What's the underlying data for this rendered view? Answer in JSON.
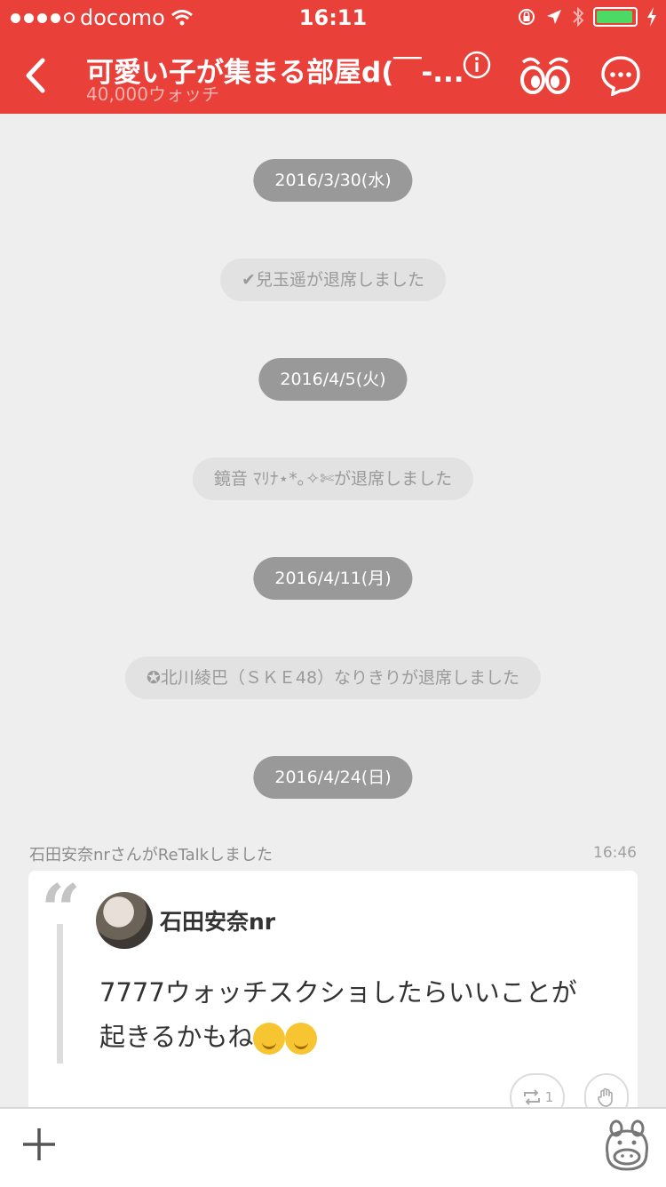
{
  "status_bar": {
    "carrier": "docomo",
    "time": "16:11"
  },
  "header": {
    "title": "可愛い子が集まる部屋d(￣-...",
    "subtitle": "40,000ウォッチ"
  },
  "timeline": {
    "items": [
      {
        "kind": "date",
        "text": "2016/3/30(水)"
      },
      {
        "kind": "system",
        "text": "✔兒玉遥が退席しました"
      },
      {
        "kind": "date",
        "text": "2016/4/5(火)"
      },
      {
        "kind": "system",
        "text": "鏡音  ﾏﾘﾅ⋆*｡✧✄が退席しました"
      },
      {
        "kind": "date",
        "text": "2016/4/11(月)"
      },
      {
        "kind": "system",
        "text": "✪北川綾巴（ＳＫＥ48）なりきりが退席しました"
      },
      {
        "kind": "date",
        "text": "2016/4/24(日)"
      }
    ]
  },
  "retalk": {
    "notice": "石田安奈nrさんがReTalkしました",
    "time": "16:46",
    "author": "石田安奈nr",
    "message_line1": "7777ウォッチスクショしたらいいことが",
    "message_line2": "起きるかもね",
    "retalk_count": "1"
  },
  "icons": {
    "back": "chevron-left-icon",
    "info": "info-icon",
    "watch": "eyes-icon",
    "talk": "chat-bubble-icon",
    "retalk": "repeat-icon",
    "like": "hand-icon",
    "add": "plus-icon",
    "mascot": "hippo-mascot-icon"
  },
  "colors": {
    "header_bg": "#e9403a",
    "date_pill": "#999999",
    "system_pill": "#e2e2e2",
    "background": "#eeeeee"
  }
}
